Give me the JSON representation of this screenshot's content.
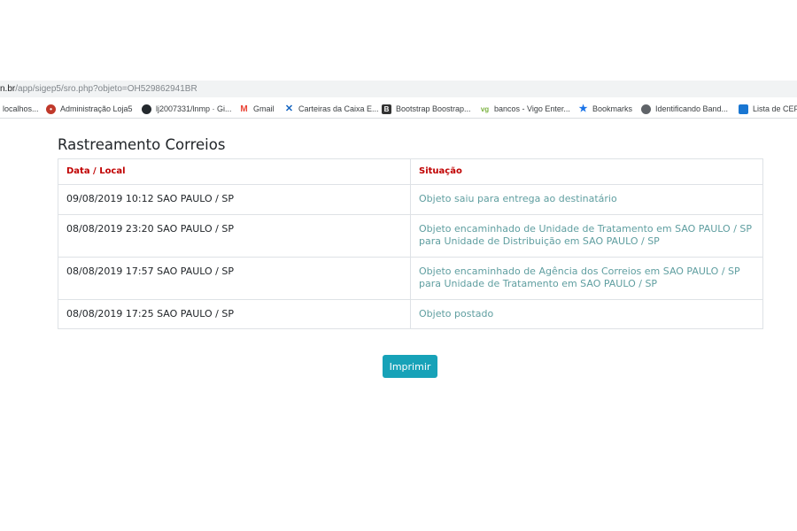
{
  "browser": {
    "url_host": "n.br",
    "url_path": "/app/sigep5/sro.php?objeto=OH529862941BR",
    "bookmarks": [
      {
        "label": "localhos...",
        "icon": "globe-icon",
        "color": "#5f6368"
      },
      {
        "label": "Administração Loja5",
        "icon": "store-icon",
        "color": "#c0392b"
      },
      {
        "label": "lj2007331/lnmp · Gi...",
        "icon": "github-icon",
        "color": "#24292e"
      },
      {
        "label": "Gmail",
        "icon": "gmail-icon",
        "color": "#ea4335"
      },
      {
        "label": "Carteiras da Caixa E...",
        "icon": "caixa-icon",
        "color": "#1565c0"
      },
      {
        "label": "Bootstrap Boostrap...",
        "icon": "bootstrap-icon",
        "color": "#333333"
      },
      {
        "label": "bancos - Vigo Enter...",
        "icon": "vigo-icon",
        "color": "#7cb342"
      },
      {
        "label": "Bookmarks",
        "icon": "star-icon",
        "color": "#1a73e8"
      },
      {
        "label": "Identificando Band...",
        "icon": "globe-icon",
        "color": "#5f6368"
      },
      {
        "label": "Lista de CEP",
        "icon": "cep-icon",
        "color": "#1976d2"
      }
    ]
  },
  "page": {
    "title": "Rastreamento Correios",
    "table": {
      "headers": [
        "Data / Local",
        "Situação"
      ],
      "rows": [
        {
          "local": "09/08/2019 10:12 SAO PAULO / SP",
          "situacao": "Objeto saiu para entrega ao destinatário"
        },
        {
          "local": "08/08/2019 23:20 SAO PAULO / SP",
          "situacao": "Objeto encaminhado de Unidade de Tratamento em SAO PAULO / SP para Unidade de Distribuição em SAO PAULO / SP"
        },
        {
          "local": "08/08/2019 17:57 SAO PAULO / SP",
          "situacao": "Objeto encaminhado de Agência dos Correios em SAO PAULO / SP para Unidade de Tratamento em SAO PAULO / SP"
        },
        {
          "local": "08/08/2019 17:25 SAO PAULO / SP",
          "situacao": "Objeto postado"
        }
      ]
    },
    "print_button": "Imprimir"
  },
  "colors": {
    "header_text": "#c00000",
    "status_text": "#5f9ea0",
    "button_bg": "#17a2b8"
  }
}
